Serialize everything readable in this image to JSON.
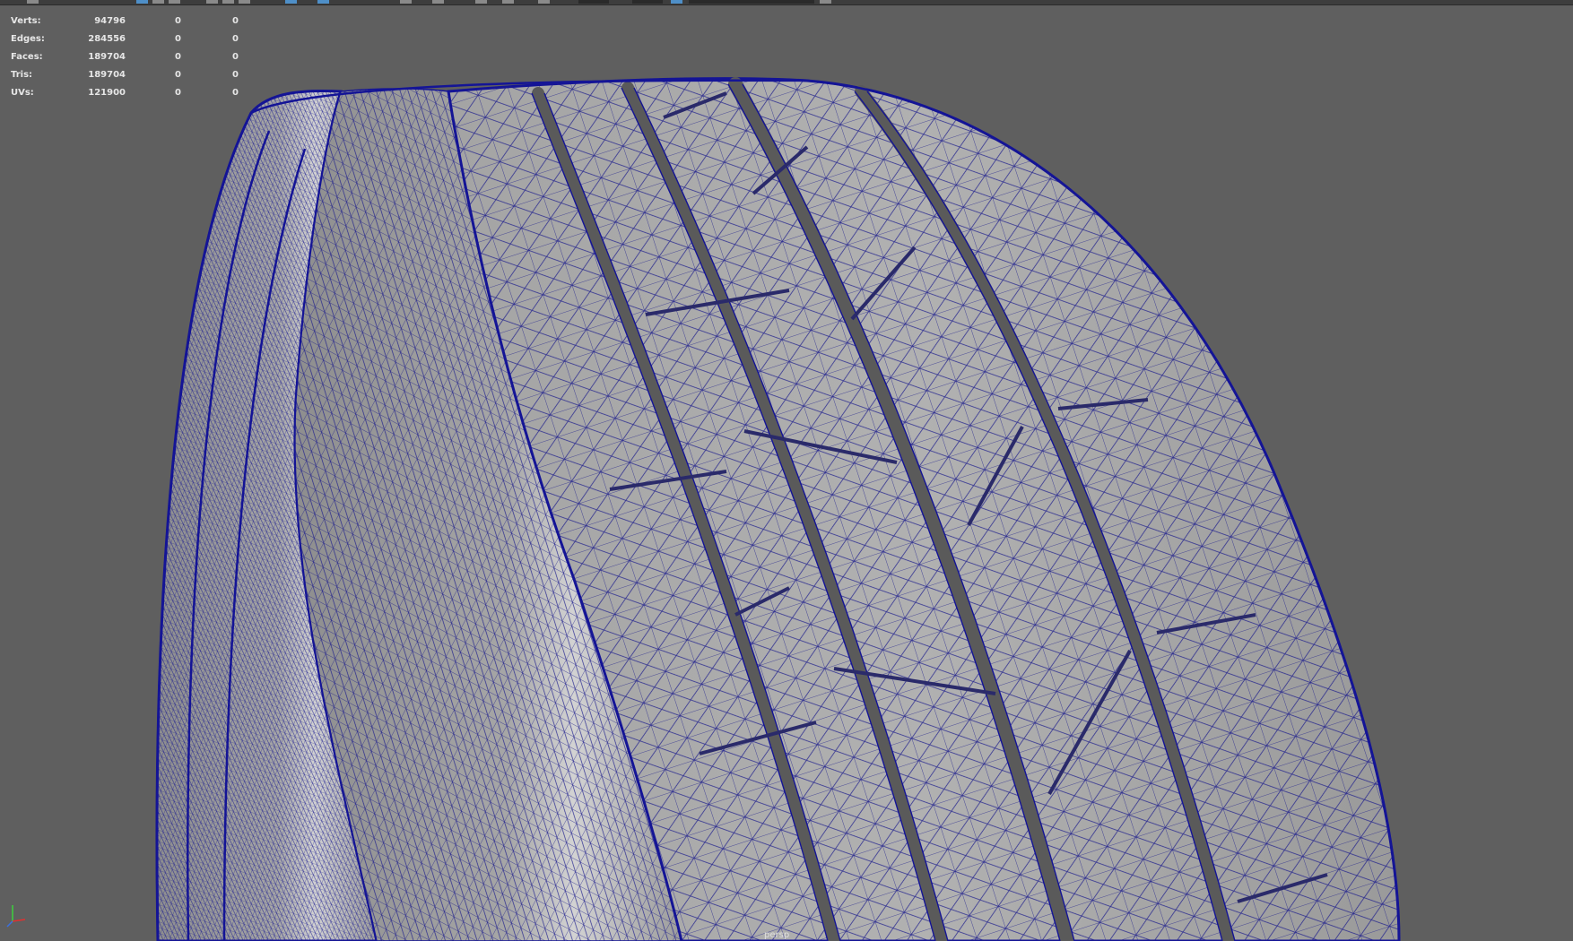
{
  "toolbar": {
    "description_icons": [
      "select-icon",
      "lasso-icon",
      "paint-icon",
      "snap-icon",
      "render-icon"
    ]
  },
  "hud": {
    "rows": [
      {
        "label": "Verts:",
        "total": "94796",
        "selected": "0",
        "selected2": "0"
      },
      {
        "label": "Edges:",
        "total": "284556",
        "selected": "0",
        "selected2": "0"
      },
      {
        "label": "Faces:",
        "total": "189704",
        "selected": "0",
        "selected2": "0"
      },
      {
        "label": "Tris:",
        "total": "189704",
        "selected": "0",
        "selected2": "0"
      },
      {
        "label": "UVs:",
        "total": "121900",
        "selected": "0",
        "selected2": "0"
      }
    ]
  },
  "viewport": {
    "camera": "persp"
  },
  "colors": {
    "background": "#5f5f5f",
    "wire": "#141496",
    "surface": "#9c9c9c"
  }
}
